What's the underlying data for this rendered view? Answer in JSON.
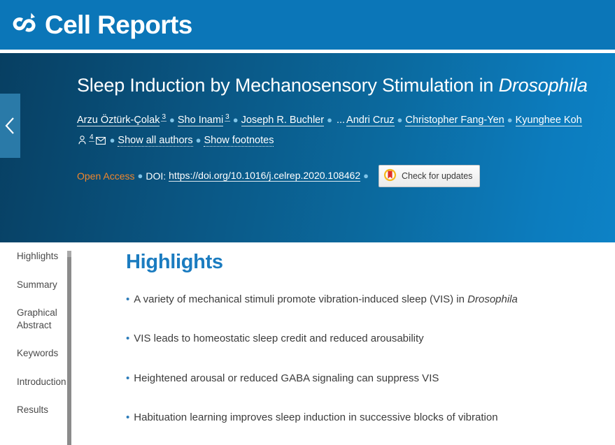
{
  "masthead": {
    "journal_name": "Cell Reports",
    "logo_icon": "cell-press-loop-icon"
  },
  "collapse_tab": {
    "icon": "chevron-left-icon"
  },
  "article": {
    "title_main": "Sleep Induction by Mechanosensory Stimulation in ",
    "title_italic": "Drosophila",
    "authors": [
      {
        "name": "Arzu Öztürk-Çolak",
        "sup": "3"
      },
      {
        "name": "Sho Inami",
        "sup": "3"
      },
      {
        "name": "Joseph R. Buchler",
        "sup": ""
      },
      {
        "name": "Andri Cruz",
        "sup": ""
      },
      {
        "name": "Christopher Fang-Yen",
        "sup": ""
      },
      {
        "name": "Kyunghee Koh",
        "sup": "4"
      }
    ],
    "author_ellipsis": "...",
    "corresponding_icon": "person-icon",
    "email_icon": "envelope-icon",
    "show_all_authors": "Show all authors",
    "show_footnotes": "Show footnotes",
    "open_access": "Open Access",
    "doi_label": "DOI:",
    "doi_url": "https://doi.org/10.1016/j.celrep.2020.108462",
    "crossmark_label": "Check for updates",
    "crossmark_icon": "crossmark-bookmark-icon"
  },
  "toc": {
    "items": [
      "Highlights",
      "Summary",
      "Graphical Abstract",
      "Keywords",
      "Introduction",
      "Results"
    ]
  },
  "main": {
    "section_title": "Highlights",
    "bullet_glyph": "•",
    "highlights": [
      {
        "text_before": "A variety of mechanical stimuli promote vibration-induced sleep (VIS) in ",
        "italic": "Drosophila",
        "text_after": ""
      },
      {
        "text_before": "VIS leads to homeostatic sleep credit and reduced arousability",
        "italic": "",
        "text_after": ""
      },
      {
        "text_before": "Heightened arousal or reduced GABA signaling can suppress VIS",
        "italic": "",
        "text_after": ""
      },
      {
        "text_before": "Habituation learning improves sleep induction in successive blocks of vibration",
        "italic": "",
        "text_after": ""
      }
    ]
  },
  "colors": {
    "masthead_blue": "#0b76b8",
    "banner_dark": "#073f62",
    "banner_light": "#0d82c6",
    "heading_blue": "#1b7cc0",
    "open_access_orange": "#f0862c",
    "bullet_blue": "#2b7bb9",
    "body_text": "#3c3c3c"
  }
}
